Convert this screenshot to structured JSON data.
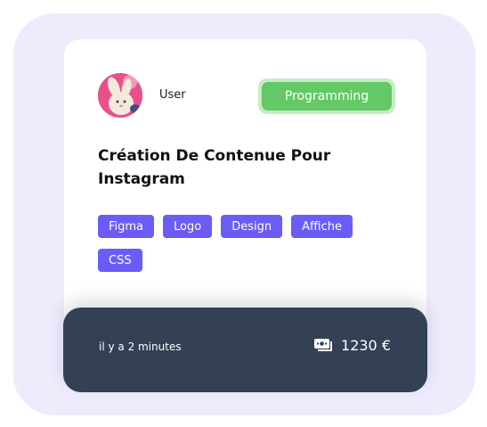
{
  "card": {
    "user": {
      "name": "User",
      "avatar_icon": "bunny-avatar-icon"
    },
    "category": "Programming",
    "title": "Création De Contenue Pour Instagram",
    "tags": [
      "Figma",
      "Logo",
      "Design",
      "Affiche",
      "CSS"
    ],
    "footer": {
      "time": "il y a 2 minutes",
      "price_icon": "money-icon",
      "price": "1230 €"
    }
  },
  "colors": {
    "outer_background": "#eeebfc",
    "card_background": "#ffffff",
    "badge_outer": "#c6ecc6",
    "badge_inner": "#63c866",
    "tag": "#6b5cf5",
    "footer": "#344054",
    "avatar": "#e9508a"
  }
}
